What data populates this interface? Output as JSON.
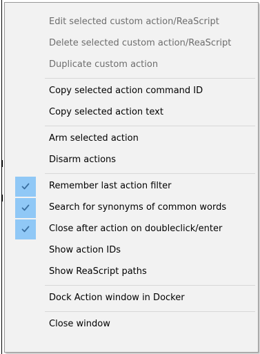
{
  "context_menu": {
    "groups": [
      {
        "items": [
          {
            "label": "Edit selected custom action/ReaScript",
            "enabled": false,
            "checked": false
          },
          {
            "label": "Delete selected custom action/ReaScript",
            "enabled": false,
            "checked": false
          },
          {
            "label": "Duplicate custom action",
            "enabled": false,
            "checked": false
          }
        ]
      },
      {
        "items": [
          {
            "label": "Copy selected action command ID",
            "enabled": true,
            "checked": false
          },
          {
            "label": "Copy selected action text",
            "enabled": true,
            "checked": false
          }
        ]
      },
      {
        "items": [
          {
            "label": "Arm selected action",
            "enabled": true,
            "checked": false
          },
          {
            "label": "Disarm actions",
            "enabled": true,
            "checked": false
          }
        ]
      },
      {
        "items": [
          {
            "label": "Remember last action filter",
            "enabled": true,
            "checked": true
          },
          {
            "label": "Search for synonyms of common words",
            "enabled": true,
            "checked": true
          },
          {
            "label": "Close after action on doubleclick/enter",
            "enabled": true,
            "checked": true
          },
          {
            "label": "Show action IDs",
            "enabled": true,
            "checked": false
          },
          {
            "label": "Show ReaScript paths",
            "enabled": true,
            "checked": false
          }
        ]
      },
      {
        "items": [
          {
            "label": "Dock Action window in Docker",
            "enabled": true,
            "checked": false
          }
        ]
      },
      {
        "items": [
          {
            "label": "Close window",
            "enabled": true,
            "checked": false
          }
        ]
      }
    ],
    "colors": {
      "menu_background": "#f2f2f2",
      "menu_border": "#979797",
      "check_highlight": "#90c8f6",
      "check_mark": "#3a6fa0",
      "disabled_text": "#6d6d6d",
      "text": "#000000",
      "separator": "#d7d7d7"
    }
  }
}
